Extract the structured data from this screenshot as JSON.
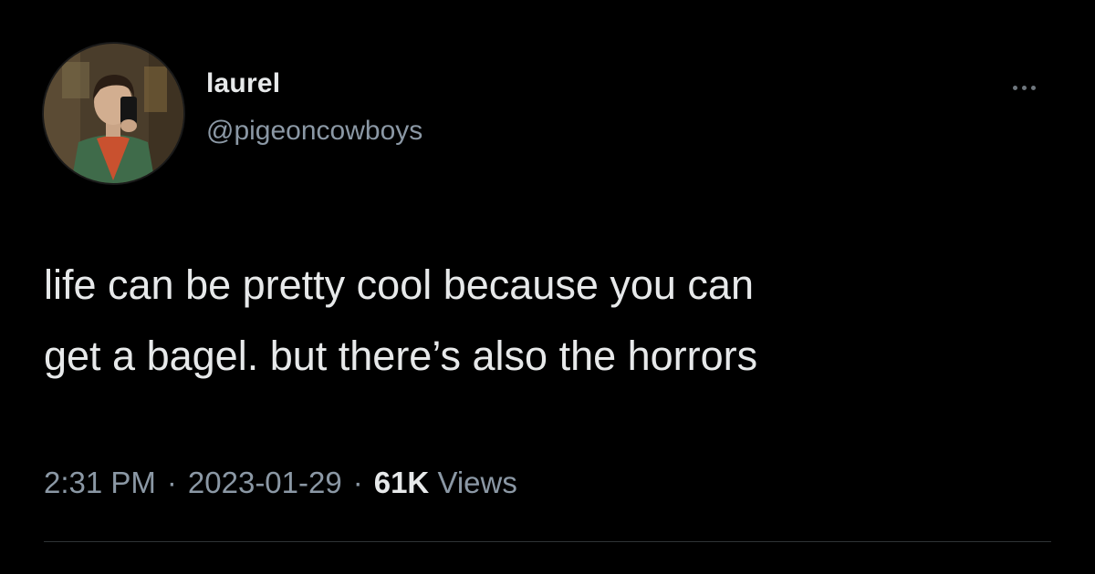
{
  "author": {
    "display_name": "laurel",
    "handle": "@pigeoncowboys",
    "avatar_icon": "profile-photo"
  },
  "tweet": {
    "text": "life can be pretty cool because you can\nget a bagel. but there’s also the horrors"
  },
  "meta": {
    "time": "2:31 PM",
    "date": "2023-01-29",
    "separator": "·",
    "views_count": "61K",
    "views_label": "Views"
  },
  "actions": {
    "more_icon": "more-horizontal-icon"
  },
  "colors": {
    "background": "#000000",
    "primary_text": "#e7e9ea",
    "secondary_text": "#8b98a5",
    "divider": "#2f3336"
  }
}
